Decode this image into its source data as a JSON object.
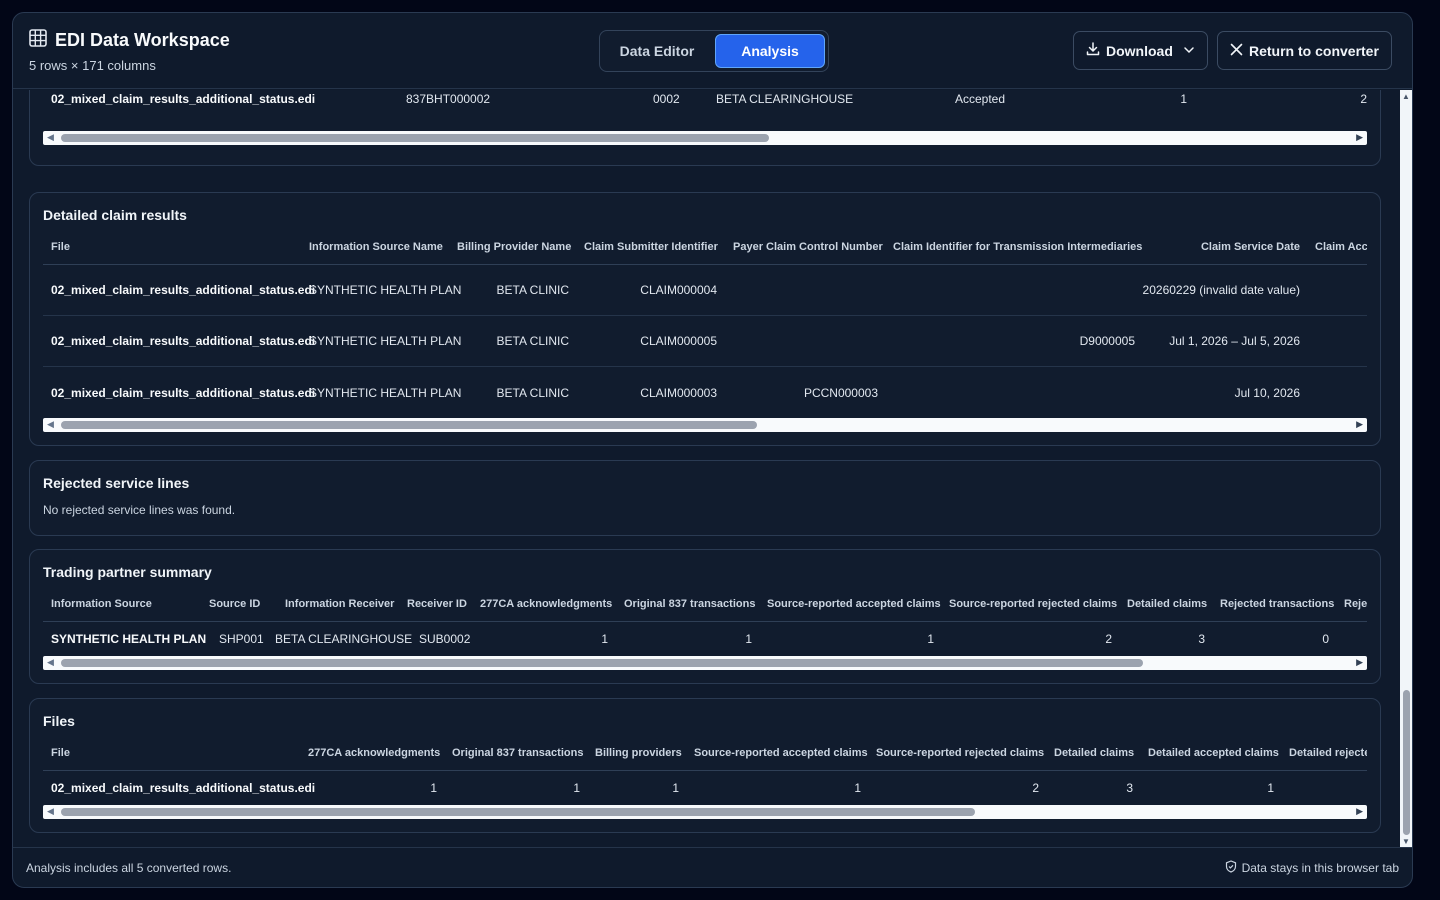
{
  "header": {
    "title": "EDI Data Workspace",
    "subtitle": "5 rows × 171 columns",
    "tabs": [
      {
        "label": "Data Editor"
      },
      {
        "label": "Analysis"
      }
    ],
    "download_label": "Download",
    "return_label": "Return to converter"
  },
  "top_partial": {
    "row": [
      "02_mixed_claim_results_additional_status.edi",
      "837BHT000002",
      "0002",
      "BETA CLEARINGHOUSE",
      "Accepted",
      "1",
      "2"
    ],
    "scroll": 0.55
  },
  "detailed": {
    "title": "Detailed claim results",
    "columns": [
      "File",
      "Information Source Name",
      "Billing Provider Name",
      "Claim Submitter Identifier",
      "Payer Claim Control Number",
      "Claim Identifier for Transmission Intermediaries",
      "Claim Service Date",
      "Claim Acce"
    ],
    "rows": [
      [
        "02_mixed_claim_results_additional_status.edi",
        "SYNTHETIC HEALTH PLAN",
        "BETA CLINIC",
        "CLAIM000004",
        "",
        "",
        "20260229 (invalid date value)",
        ""
      ],
      [
        "02_mixed_claim_results_additional_status.edi",
        "SYNTHETIC HEALTH PLAN",
        "BETA CLINIC",
        "CLAIM000005",
        "",
        "D9000005",
        "Jul 1, 2026 – Jul 5, 2026",
        ""
      ],
      [
        "02_mixed_claim_results_additional_status.edi",
        "SYNTHETIC HEALTH PLAN",
        "BETA CLINIC",
        "CLAIM000003",
        "PCCN000003",
        "",
        "Jul 10, 2026",
        ""
      ]
    ],
    "scroll": 0.54
  },
  "rejected": {
    "title": "Rejected service lines",
    "message": "No rejected service lines was found."
  },
  "trading": {
    "title": "Trading partner summary",
    "columns": [
      "Information Source",
      "Source ID",
      "Information Receiver",
      "Receiver ID",
      "277CA acknowledgments",
      "Original 837 transactions",
      "Source-reported accepted claims",
      "Source-reported rejected claims",
      "Detailed claims",
      "Rejected transactions",
      "Reje"
    ],
    "rows": [
      [
        "SYNTHETIC HEALTH PLAN",
        "SHP001",
        "BETA CLEARINGHOUSE",
        "SUB0002",
        "1",
        "1",
        "1",
        "2",
        "3",
        "0",
        ""
      ]
    ],
    "scroll": 0.84
  },
  "files": {
    "title": "Files",
    "columns": [
      "File",
      "277CA acknowledgments",
      "Original 837 transactions",
      "Billing providers",
      "Source-reported accepted claims",
      "Source-reported rejected claims",
      "Detailed claims",
      "Detailed accepted claims",
      "Detailed rejecte"
    ],
    "rows": [
      [
        "02_mixed_claim_results_additional_status.edi",
        "1",
        "1",
        "1",
        "1",
        "2",
        "3",
        "1",
        ""
      ]
    ],
    "scroll": 0.71
  },
  "footer": {
    "left": "Analysis includes all 5 converted rows.",
    "right": "Data stays in this browser tab"
  }
}
